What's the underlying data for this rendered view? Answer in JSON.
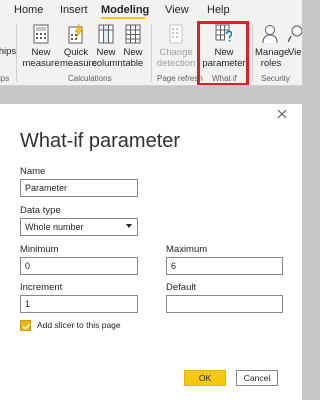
{
  "ribbon": {
    "tabs": [
      {
        "label": "Home"
      },
      {
        "label": "Insert"
      },
      {
        "label": "Modeling"
      },
      {
        "label": "View"
      },
      {
        "label": "Help"
      }
    ],
    "active_tab": "Modeling",
    "buttons": {
      "relationships_partial": "ships",
      "new_measure": "New measure",
      "quick_measure": "Quick measure",
      "new_column": "New column",
      "new_table": "New table",
      "change_detection": "Change detection",
      "new_parameter": "New parameter",
      "manage_roles": "Manage roles",
      "view_as_partial": "Vie as"
    },
    "groups": {
      "relationships_partial": "ips",
      "calculations": "Calculations",
      "page_refresh": "Page refresh",
      "what_if": "What if",
      "security": "Security"
    },
    "highlight_color": "#e01e26",
    "accent_color": "#f2c811"
  },
  "dialog": {
    "title": "What-if parameter",
    "name_label": "Name",
    "name_value": "Parameter",
    "datatype_label": "Data type",
    "datatype_value": "Whole number",
    "minimum_label": "Minimum",
    "minimum_value": "0",
    "maximum_label": "Maximum",
    "maximum_value": "6",
    "increment_label": "Increment",
    "increment_value": "1",
    "default_label": "Default",
    "default_value": "",
    "slider_checkbox_label": "Add slicer to this page",
    "slider_checked": true,
    "ok_label": "OK",
    "cancel_label": "Cancel"
  }
}
